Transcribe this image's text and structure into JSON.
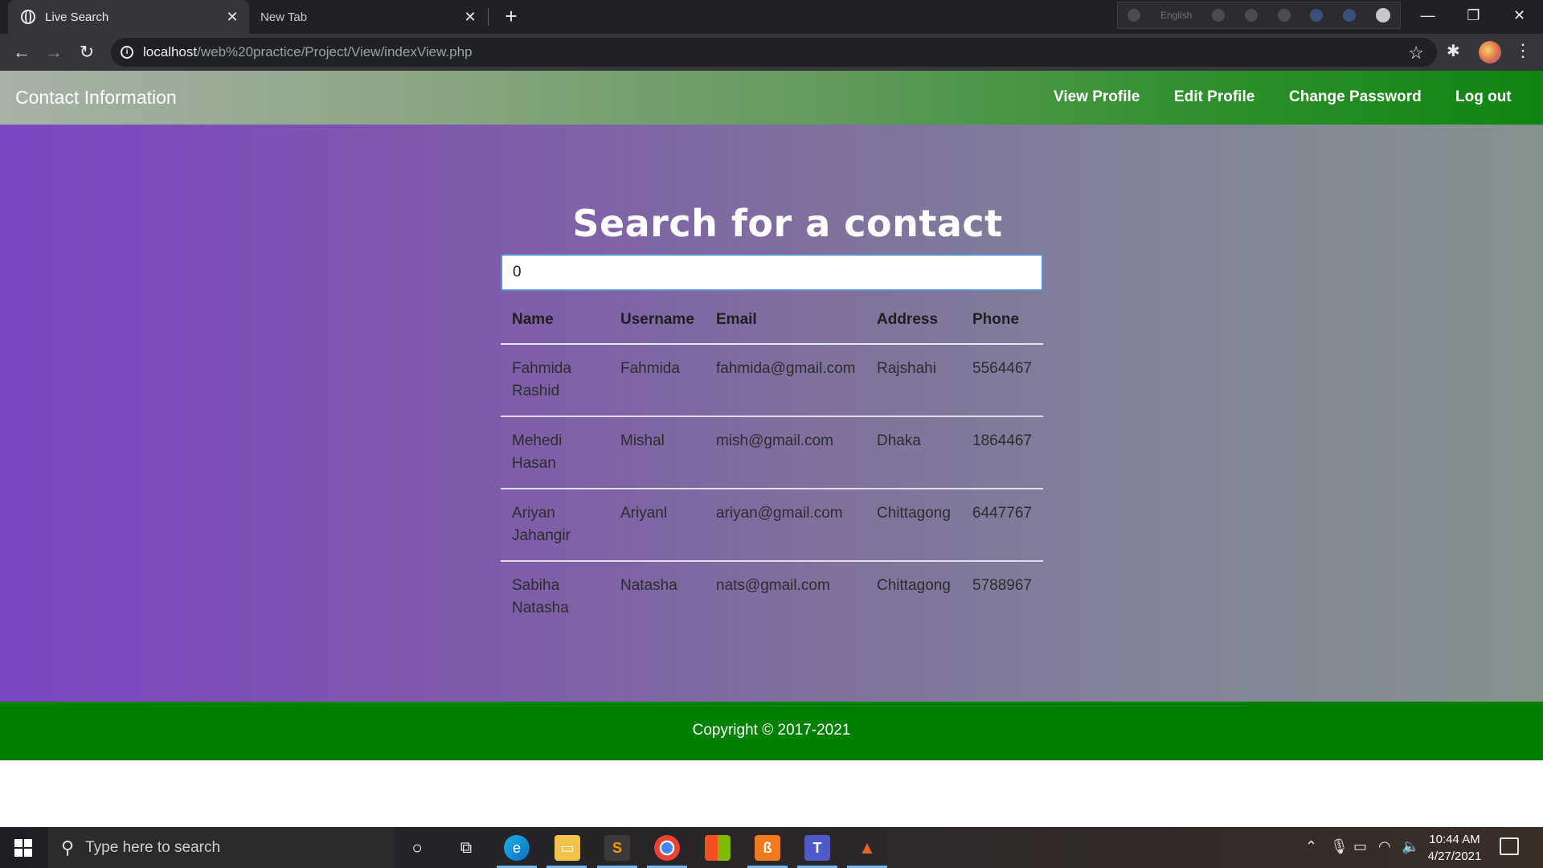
{
  "browser": {
    "tabs": [
      {
        "title": "Live Search",
        "active": true
      },
      {
        "title": "New Tab",
        "active": false
      }
    ],
    "url_host": "localhost",
    "url_path": "/web%20practice/Project/View/indexView.php",
    "ime_language": "English"
  },
  "navbar": {
    "brand": "Contact Information",
    "links": [
      "View Profile",
      "Edit Profile",
      "Change Password",
      "Log out"
    ]
  },
  "search": {
    "title": "Search for a contact",
    "query": "0"
  },
  "table": {
    "headers": [
      "Name",
      "Username",
      "Email",
      "Address",
      "Phone"
    ],
    "rows": [
      {
        "name": "Fahmida Rashid",
        "username": "Fahmida",
        "email": "fahmida@gmail.com",
        "address": "Rajshahi",
        "phone": "5564467"
      },
      {
        "name": "Mehedi Hasan",
        "username": "Mishal",
        "email": "mish@gmail.com",
        "address": "Dhaka",
        "phone": "1864467"
      },
      {
        "name": "Ariyan Jahangir",
        "username": "Ariyanl",
        "email": "ariyan@gmail.com",
        "address": "Chittagong",
        "phone": "6447767"
      },
      {
        "name": "Sabiha Natasha",
        "username": "Natasha",
        "email": "nats@gmail.com",
        "address": "Chittagong",
        "phone": "5788967"
      }
    ]
  },
  "footer": {
    "text": "Copyright © 2017-2021"
  },
  "taskbar": {
    "search_placeholder": "Type here to search",
    "time": "10:44 AM",
    "date": "4/27/2021"
  },
  "colors": {
    "navbar_gradient_end": "#118411",
    "hero_gradient_start": "#7a47c3",
    "footer": "#008000"
  }
}
